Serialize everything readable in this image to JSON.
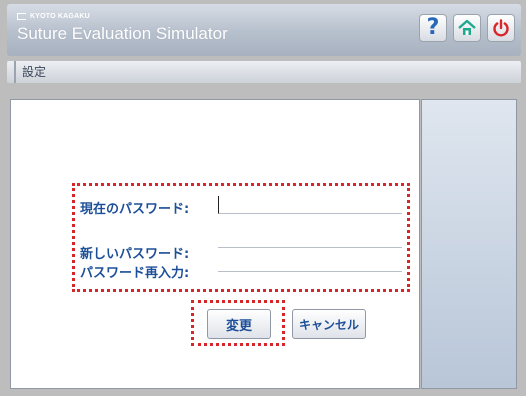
{
  "header": {
    "brand": "KYOTO KAGAKU",
    "app_title": "Suture Evaluation Simulator",
    "icons": [
      "help-icon",
      "home-icon",
      "power-icon"
    ],
    "help_glyph": "?"
  },
  "section": {
    "title": "設定"
  },
  "form": {
    "current_password_label": "現在のパスワード:",
    "new_password_label": "新しいパスワード:",
    "confirm_password_label": "パスワード再入力:",
    "current_password_value": "",
    "new_password_value": "",
    "confirm_password_value": ""
  },
  "buttons": {
    "change": "変更",
    "cancel": "キャンセル"
  },
  "colors": {
    "label": "#1d4f99",
    "highlight": "#d7262a",
    "home": "#1fa98f",
    "power": "#d9262a"
  }
}
